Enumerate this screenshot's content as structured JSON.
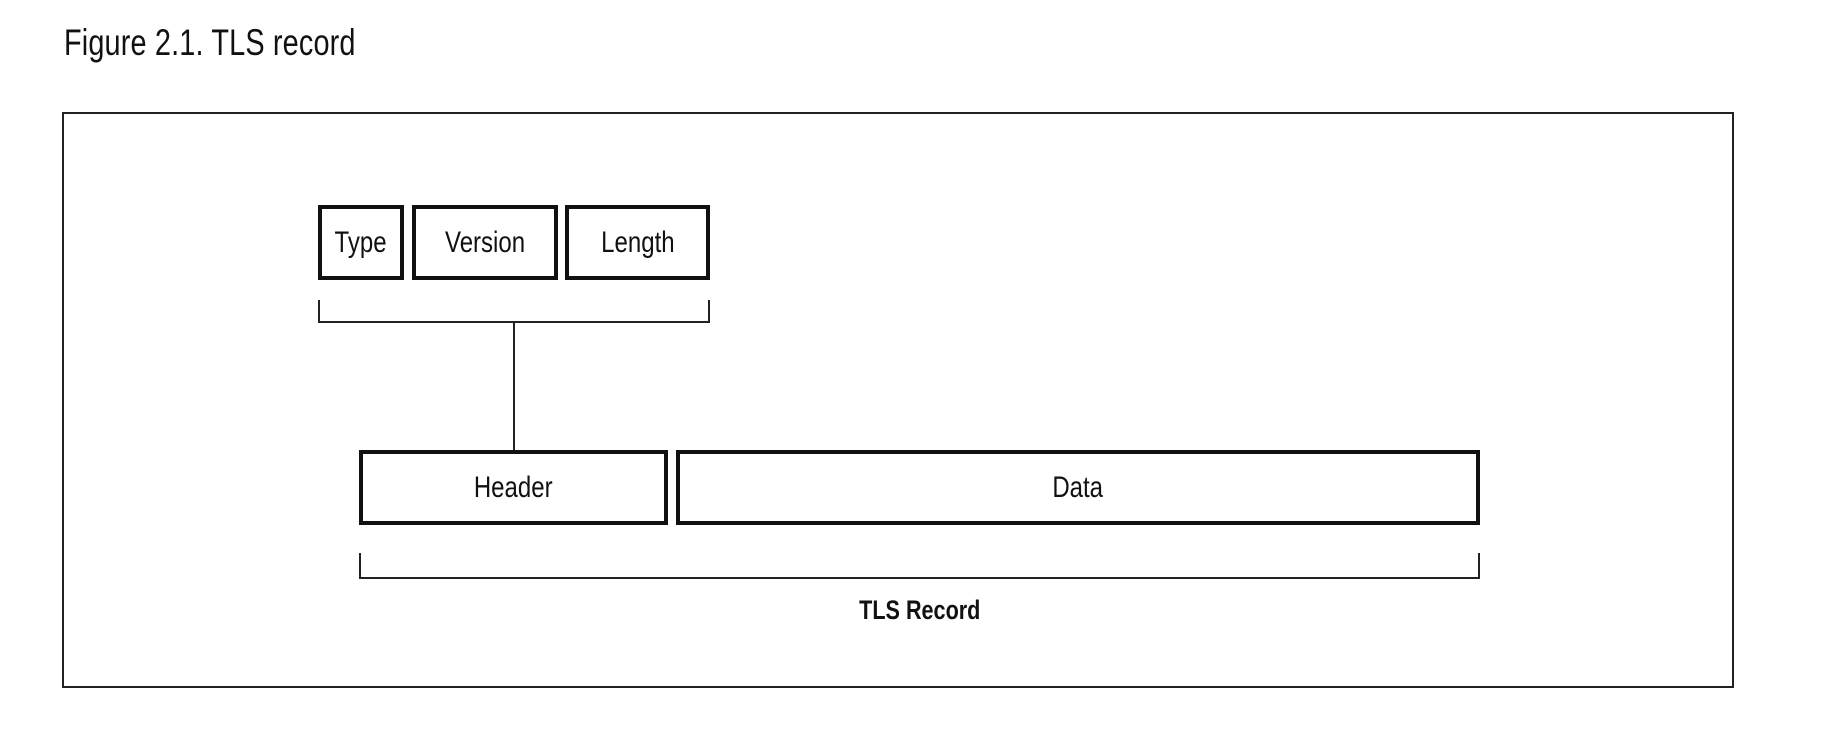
{
  "figure": {
    "title": "Figure 2.1. TLS record"
  },
  "diagram": {
    "header_fields": [
      {
        "label": "Type"
      },
      {
        "label": "Version"
      },
      {
        "label": "Length"
      }
    ],
    "record_parts": [
      {
        "label": "Header"
      },
      {
        "label": "Data"
      }
    ],
    "record_caption": "TLS Record"
  }
}
